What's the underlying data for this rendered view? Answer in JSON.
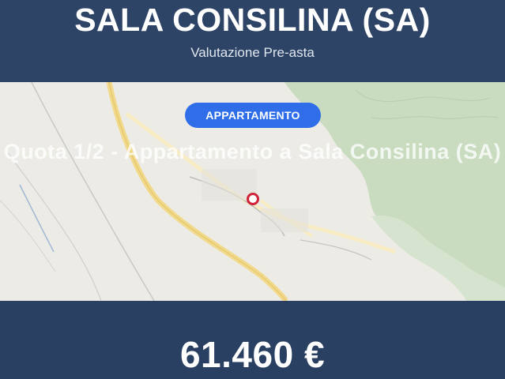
{
  "header": {
    "title": "SALA CONSILINA (SA)",
    "subtitle": "Valutazione Pre-asta"
  },
  "map": {
    "badge": "APPARTAMENTO",
    "overlay_text": "Quota 1/2 - Appartamento a Sala Consilina (SA)",
    "pin_icon": "location-pin-icon"
  },
  "footer": {
    "price": "61.460 €"
  },
  "colors": {
    "header_bg": "#2d4466",
    "badge_bg": "#2f6ee8",
    "pin": "#d0233a",
    "map_bg": "#ecebe6",
    "map_green": "#c9dcc0"
  }
}
